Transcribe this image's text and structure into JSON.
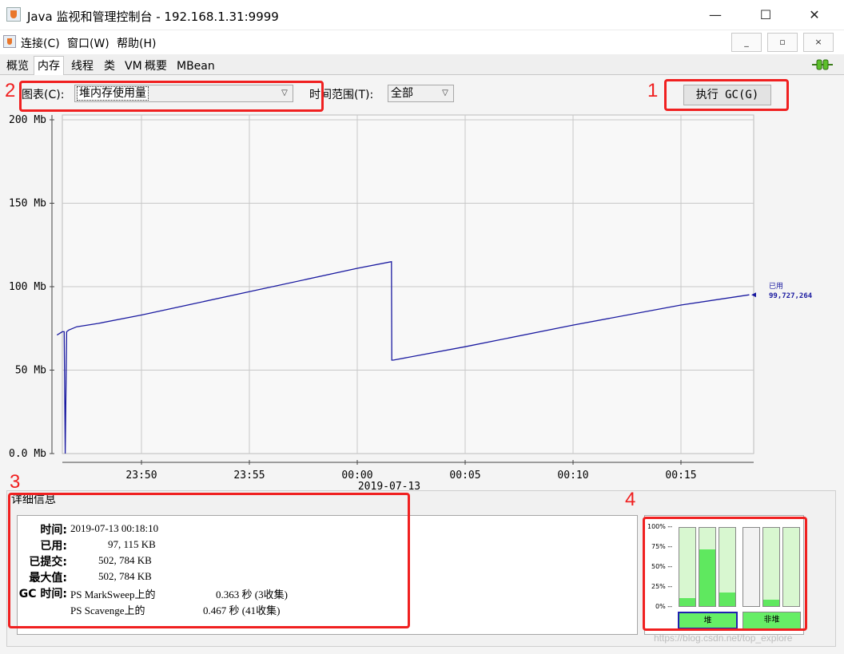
{
  "window": {
    "title": "Java 监视和管理控制台 - 192.168.1.31:9999",
    "minimize": "—",
    "maximize": "☐",
    "close": "✕"
  },
  "menu": {
    "items": [
      "连接(C)",
      "窗口(W)",
      "帮助(H)"
    ],
    "mdi": [
      "_",
      "▫",
      "×"
    ]
  },
  "tabs": [
    "概览",
    "内存",
    "线程",
    "类",
    "VM",
    "概要",
    "MBean"
  ],
  "active_tab": "内存",
  "controls": {
    "chart_label": "图表(C):",
    "chart_value": "堆内存使用量",
    "range_label": "时间范围(T):",
    "range_value": "全部",
    "gc_button": "执行 GC(G)"
  },
  "annotations": [
    "1",
    "2",
    "3",
    "4"
  ],
  "chart_data": {
    "type": "line",
    "ylim": [
      0,
      200
    ],
    "y_ticks": [
      "200 Mb",
      "150 Mb",
      "100 Mb",
      "50 Mb",
      "0.0 Mb"
    ],
    "x_ticks": [
      "23:50",
      "23:55",
      "00:00",
      "00:05",
      "00:10",
      "00:15"
    ],
    "x_date_label": "2019-07-13",
    "series_color": "#1a1aa0",
    "series": [
      {
        "name": "已用",
        "x": [
          "23:46:05",
          "23:46:20",
          "23:46:25",
          "23:46:28",
          "23:46:32",
          "23:46:38",
          "23:47:00",
          "23:48:00",
          "23:50:00",
          "23:55:00",
          "00:00:00",
          "00:01:35",
          "00:01:36",
          "00:01:40",
          "00:05:00",
          "00:10:00",
          "00:15:00",
          "00:18:10"
        ],
        "y": [
          71,
          73,
          73,
          0,
          73,
          74,
          76,
          78,
          83,
          97,
          111,
          115,
          56,
          56,
          64,
          77,
          89,
          95.1
        ]
      }
    ],
    "legend_name": "已用",
    "legend_value": "99,727,264"
  },
  "details": {
    "group_title": "详细信息",
    "rows": [
      {
        "key": "时间:",
        "value": "2019-07-13 00:18:10"
      },
      {
        "key": "已用:",
        "value": "97, 115 KB"
      },
      {
        "key": "已提交:",
        "value": "502, 784 KB"
      },
      {
        "key": "最大值:",
        "value": "502, 784 KB"
      }
    ],
    "gc_key": "GC 时间:",
    "gc_rows": [
      {
        "name": "PS MarkSweep上的",
        "value": "0.363 秒 (3收集)"
      },
      {
        "name": "PS Scavenge上的",
        "value": "0.467 秒 (41收集)"
      }
    ]
  },
  "pools": {
    "pct_labels": [
      "100% --",
      "75% --",
      "50% --",
      "25% --",
      "0% --"
    ],
    "heap_bars": [
      0.1,
      0.72,
      0.17
    ],
    "nonheap_bars": [
      0.0,
      0.08,
      0.0
    ],
    "heap_label": "堆",
    "nonheap_label": "非堆"
  },
  "watermark": "https://blog.csdn.net/top_explore"
}
